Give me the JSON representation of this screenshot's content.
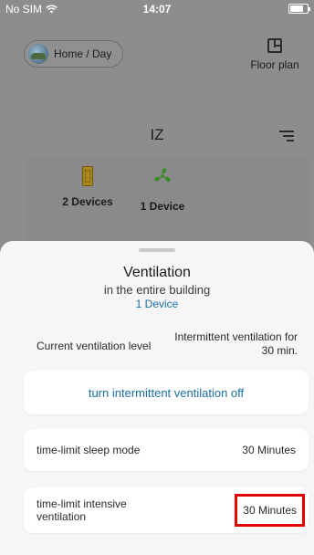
{
  "status_bar": {
    "carrier": "No SIM",
    "time": "14:07"
  },
  "header": {
    "home_chip_label": "Home / Day",
    "floor_plan_label": "Floor plan"
  },
  "room": {
    "name": "IZ"
  },
  "devices_summary": [
    {
      "label": "2 Devices",
      "icon": "door-icon"
    },
    {
      "label": "1 Device",
      "icon": "fan-icon"
    }
  ],
  "sheet": {
    "title": "Ventilation",
    "subtitle": "in the entire building",
    "device_count": "1 Device",
    "current_level_label": "Current ventilation level",
    "current_level_value": "Intermittent ventilation for 30 min.",
    "action_label": "turn intermittent ventilation off",
    "rows": [
      {
        "label": "time-limit sleep mode",
        "value": "30 Minutes"
      },
      {
        "label": "time-limit intensive ventilation",
        "value": "30 Minutes"
      }
    ]
  },
  "colors": {
    "accent": "#1a6fa3",
    "highlight_border": "#e00000",
    "door_icon": "#a7861c",
    "fan_icon": "#3d8a2e"
  }
}
